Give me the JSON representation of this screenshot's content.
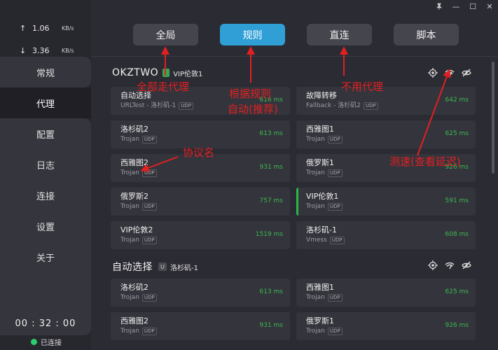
{
  "window_controls": {
    "pin": "📌",
    "minimize": "—",
    "maximize": "☐",
    "close": "✕"
  },
  "traffic": {
    "up": {
      "arrow": "↑",
      "value": "1.06",
      "unit": "KB/s"
    },
    "down": {
      "arrow": "↓",
      "value": "3.36",
      "unit": "KB/s"
    }
  },
  "sidebar": {
    "items": [
      {
        "label": "常规"
      },
      {
        "label": "代理"
      },
      {
        "label": "配置"
      },
      {
        "label": "日志"
      },
      {
        "label": "连接"
      },
      {
        "label": "设置"
      },
      {
        "label": "关于"
      }
    ],
    "active_index": 1,
    "uptime": "00 : 32 : 00",
    "status": "已连接"
  },
  "modes": {
    "global": "全局",
    "rule": "规则",
    "direct": "直连",
    "script": "脚本",
    "active": "rule"
  },
  "groups": [
    {
      "name": "OKZTWO",
      "selected": "VIP伦敦1",
      "proxies": [
        {
          "name": "自动选择",
          "type": "URLTest - 洛杉矶-1",
          "udp": "UDP",
          "delay": "616 ms"
        },
        {
          "name": "故障转移",
          "type": "Fallback - 洛杉矶2",
          "udp": "UDP",
          "delay": "642 ms"
        },
        {
          "name": "洛杉矶2",
          "type": "Trojan",
          "udp": "UDP",
          "delay": "613 ms"
        },
        {
          "name": "西雅图1",
          "type": "Trojan",
          "udp": "UDP",
          "delay": "625 ms"
        },
        {
          "name": "西雅图2",
          "type": "Trojan",
          "udp": "UDP",
          "delay": "931 ms"
        },
        {
          "name": "俄罗斯1",
          "type": "Trojan",
          "udp": "UDP",
          "delay": "926 ms"
        },
        {
          "name": "俄罗斯2",
          "type": "Trojan",
          "udp": "UDP",
          "delay": "757 ms"
        },
        {
          "name": "VIP伦敦1",
          "type": "Trojan",
          "udp": "UDP",
          "delay": "591 ms"
        },
        {
          "name": "VIP伦敦2",
          "type": "Trojan",
          "udp": "UDP",
          "delay": "1519 ms"
        },
        {
          "name": "洛杉矶-1",
          "type": "Vmess",
          "udp": "UDP",
          "delay": "608 ms"
        }
      ]
    },
    {
      "name": "自动选择",
      "badge": "U",
      "selected": "洛杉矶-1",
      "proxies": [
        {
          "name": "洛杉矶2",
          "type": "Trojan",
          "udp": "UDP",
          "delay": "613 ms"
        },
        {
          "name": "西雅图1",
          "type": "Trojan",
          "udp": "UDP",
          "delay": "625 ms"
        },
        {
          "name": "西雅图2",
          "type": "Trojan",
          "udp": "UDP",
          "delay": "931 ms"
        },
        {
          "name": "俄罗斯1",
          "type": "Trojan",
          "udp": "UDP",
          "delay": "926 ms"
        }
      ]
    }
  ],
  "annotations": {
    "global": "全部走代理",
    "rule_line1": "根据规则",
    "rule_line2": "自动(推荐)",
    "direct": "不用代理",
    "protocol": "协议名",
    "speedtest": "测速(查看延迟)"
  },
  "colors": {
    "accent": "#2f9fd6",
    "delay_ok": "#3cb94e",
    "annotation": "#e32020",
    "connected": "#2ecc71"
  },
  "icons": [
    "locate-icon",
    "speedtest-icon",
    "eye-off-icon"
  ]
}
